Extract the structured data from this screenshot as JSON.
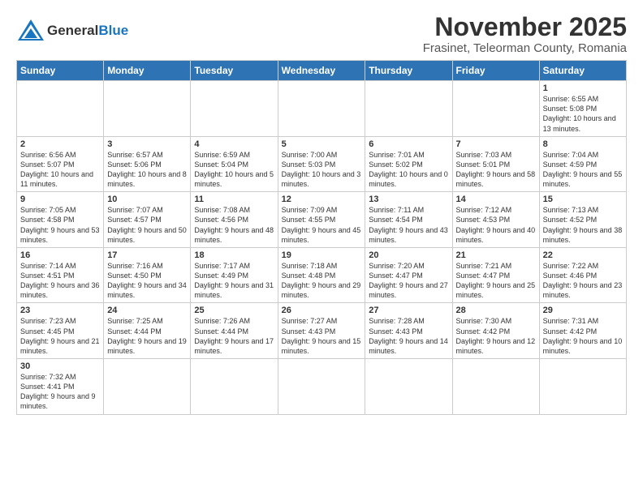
{
  "header": {
    "logo_general": "General",
    "logo_blue": "Blue",
    "month": "November 2025",
    "location": "Frasinet, Teleorman County, Romania"
  },
  "days_of_week": [
    "Sunday",
    "Monday",
    "Tuesday",
    "Wednesday",
    "Thursday",
    "Friday",
    "Saturday"
  ],
  "weeks": [
    [
      {
        "day": "",
        "info": ""
      },
      {
        "day": "",
        "info": ""
      },
      {
        "day": "",
        "info": ""
      },
      {
        "day": "",
        "info": ""
      },
      {
        "day": "",
        "info": ""
      },
      {
        "day": "",
        "info": ""
      },
      {
        "day": "1",
        "info": "Sunrise: 6:55 AM\nSunset: 5:08 PM\nDaylight: 10 hours and 13 minutes."
      }
    ],
    [
      {
        "day": "2",
        "info": "Sunrise: 6:56 AM\nSunset: 5:07 PM\nDaylight: 10 hours and 11 minutes."
      },
      {
        "day": "3",
        "info": "Sunrise: 6:57 AM\nSunset: 5:06 PM\nDaylight: 10 hours and 8 minutes."
      },
      {
        "day": "4",
        "info": "Sunrise: 6:59 AM\nSunset: 5:04 PM\nDaylight: 10 hours and 5 minutes."
      },
      {
        "day": "5",
        "info": "Sunrise: 7:00 AM\nSunset: 5:03 PM\nDaylight: 10 hours and 3 minutes."
      },
      {
        "day": "6",
        "info": "Sunrise: 7:01 AM\nSunset: 5:02 PM\nDaylight: 10 hours and 0 minutes."
      },
      {
        "day": "7",
        "info": "Sunrise: 7:03 AM\nSunset: 5:01 PM\nDaylight: 9 hours and 58 minutes."
      },
      {
        "day": "8",
        "info": "Sunrise: 7:04 AM\nSunset: 4:59 PM\nDaylight: 9 hours and 55 minutes."
      }
    ],
    [
      {
        "day": "9",
        "info": "Sunrise: 7:05 AM\nSunset: 4:58 PM\nDaylight: 9 hours and 53 minutes."
      },
      {
        "day": "10",
        "info": "Sunrise: 7:07 AM\nSunset: 4:57 PM\nDaylight: 9 hours and 50 minutes."
      },
      {
        "day": "11",
        "info": "Sunrise: 7:08 AM\nSunset: 4:56 PM\nDaylight: 9 hours and 48 minutes."
      },
      {
        "day": "12",
        "info": "Sunrise: 7:09 AM\nSunset: 4:55 PM\nDaylight: 9 hours and 45 minutes."
      },
      {
        "day": "13",
        "info": "Sunrise: 7:11 AM\nSunset: 4:54 PM\nDaylight: 9 hours and 43 minutes."
      },
      {
        "day": "14",
        "info": "Sunrise: 7:12 AM\nSunset: 4:53 PM\nDaylight: 9 hours and 40 minutes."
      },
      {
        "day": "15",
        "info": "Sunrise: 7:13 AM\nSunset: 4:52 PM\nDaylight: 9 hours and 38 minutes."
      }
    ],
    [
      {
        "day": "16",
        "info": "Sunrise: 7:14 AM\nSunset: 4:51 PM\nDaylight: 9 hours and 36 minutes."
      },
      {
        "day": "17",
        "info": "Sunrise: 7:16 AM\nSunset: 4:50 PM\nDaylight: 9 hours and 34 minutes."
      },
      {
        "day": "18",
        "info": "Sunrise: 7:17 AM\nSunset: 4:49 PM\nDaylight: 9 hours and 31 minutes."
      },
      {
        "day": "19",
        "info": "Sunrise: 7:18 AM\nSunset: 4:48 PM\nDaylight: 9 hours and 29 minutes."
      },
      {
        "day": "20",
        "info": "Sunrise: 7:20 AM\nSunset: 4:47 PM\nDaylight: 9 hours and 27 minutes."
      },
      {
        "day": "21",
        "info": "Sunrise: 7:21 AM\nSunset: 4:47 PM\nDaylight: 9 hours and 25 minutes."
      },
      {
        "day": "22",
        "info": "Sunrise: 7:22 AM\nSunset: 4:46 PM\nDaylight: 9 hours and 23 minutes."
      }
    ],
    [
      {
        "day": "23",
        "info": "Sunrise: 7:23 AM\nSunset: 4:45 PM\nDaylight: 9 hours and 21 minutes."
      },
      {
        "day": "24",
        "info": "Sunrise: 7:25 AM\nSunset: 4:44 PM\nDaylight: 9 hours and 19 minutes."
      },
      {
        "day": "25",
        "info": "Sunrise: 7:26 AM\nSunset: 4:44 PM\nDaylight: 9 hours and 17 minutes."
      },
      {
        "day": "26",
        "info": "Sunrise: 7:27 AM\nSunset: 4:43 PM\nDaylight: 9 hours and 15 minutes."
      },
      {
        "day": "27",
        "info": "Sunrise: 7:28 AM\nSunset: 4:43 PM\nDaylight: 9 hours and 14 minutes."
      },
      {
        "day": "28",
        "info": "Sunrise: 7:30 AM\nSunset: 4:42 PM\nDaylight: 9 hours and 12 minutes."
      },
      {
        "day": "29",
        "info": "Sunrise: 7:31 AM\nSunset: 4:42 PM\nDaylight: 9 hours and 10 minutes."
      }
    ],
    [
      {
        "day": "30",
        "info": "Sunrise: 7:32 AM\nSunset: 4:41 PM\nDaylight: 9 hours and 9 minutes."
      },
      {
        "day": "",
        "info": ""
      },
      {
        "day": "",
        "info": ""
      },
      {
        "day": "",
        "info": ""
      },
      {
        "day": "",
        "info": ""
      },
      {
        "day": "",
        "info": ""
      },
      {
        "day": "",
        "info": ""
      }
    ]
  ]
}
